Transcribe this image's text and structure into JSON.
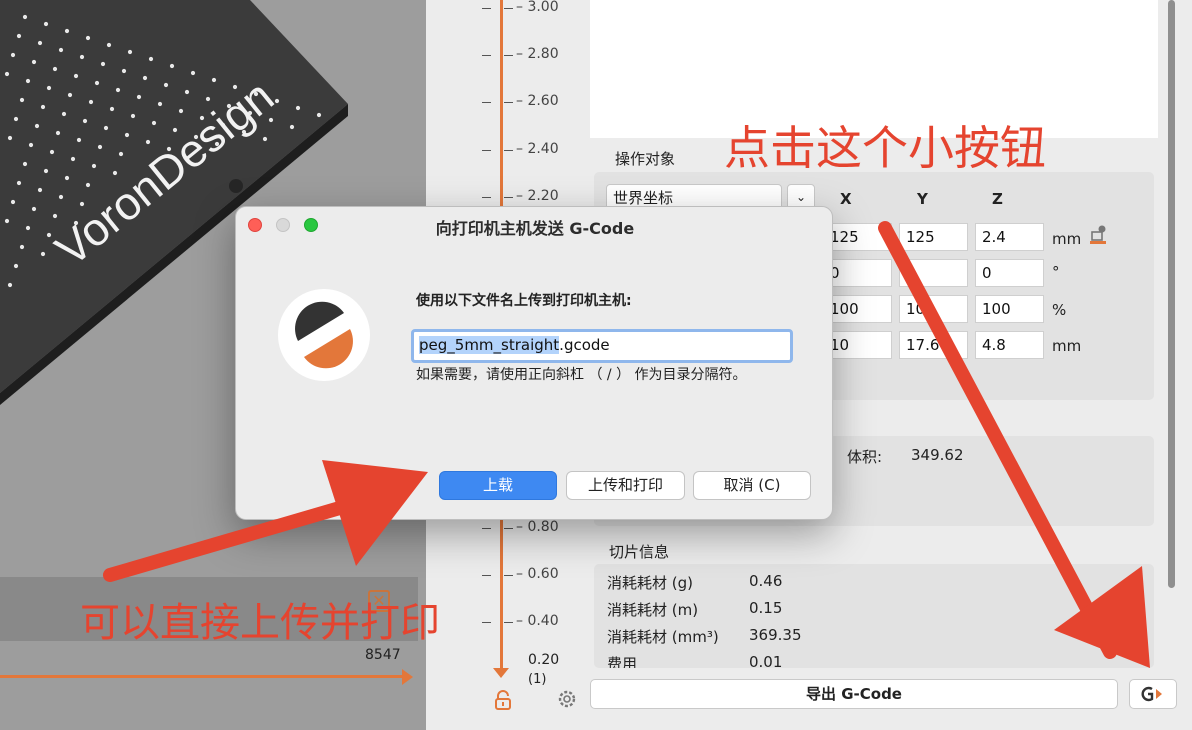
{
  "viewport": {
    "bed_brand": "VoronDesign",
    "horizontal_slider_value": "8547"
  },
  "ruler": {
    "ticks": [
      "3.00",
      "2.80",
      "2.60",
      "2.40",
      "2.20",
      "0.80",
      "0.60",
      "0.40"
    ],
    "bottom_value": "0.20",
    "bottom_count": "(1)"
  },
  "panel": {
    "object_section_title": "操作对象",
    "coord_system": "世界坐标",
    "axes": {
      "x": "X",
      "y": "Y",
      "z": "Z"
    },
    "position": {
      "x": "125",
      "y": "125",
      "z": "2.4",
      "unit": "mm"
    },
    "rotation": {
      "x": "0",
      "y": "",
      "z": "0",
      "unit": "°"
    },
    "scale": {
      "x": "100",
      "y": "10",
      "z": "100",
      "unit": "%"
    },
    "size": {
      "x": "10",
      "y": "17.6",
      "z": "4.8",
      "unit": "mm"
    },
    "volume_label": "体积:",
    "volume_value": "349.62",
    "slice_section_title": "切片信息",
    "slice_info": [
      {
        "label": "消耗耗材 (g)",
        "value": "0.46"
      },
      {
        "label": "消耗耗材 (m)",
        "value": "0.15"
      },
      {
        "label": "消耗耗材 (mm³)",
        "value": "369.35"
      },
      {
        "label": "费用",
        "value": "0.01"
      }
    ],
    "export_button": "导出 G-Code"
  },
  "dialog": {
    "title": "向打印机主机发送 G-Code",
    "prompt": "使用以下文件名上传到打印机主机:",
    "filename_selected": "peg_5mm_straight",
    "filename_ext": ".gcode",
    "hint": "如果需要，请使用正向斜杠 （ / ） 作为目录分隔符。",
    "buttons": {
      "upload": "上载",
      "upload_print": "上传和打印",
      "cancel": "取消 (C)"
    }
  },
  "annotations": {
    "top": "点击这个小按钮",
    "bottom": "可以直接上传并打印"
  },
  "colors": {
    "accent_orange": "#e3773a",
    "annotation_red": "#e5442f",
    "primary_blue": "#3e89f2"
  }
}
